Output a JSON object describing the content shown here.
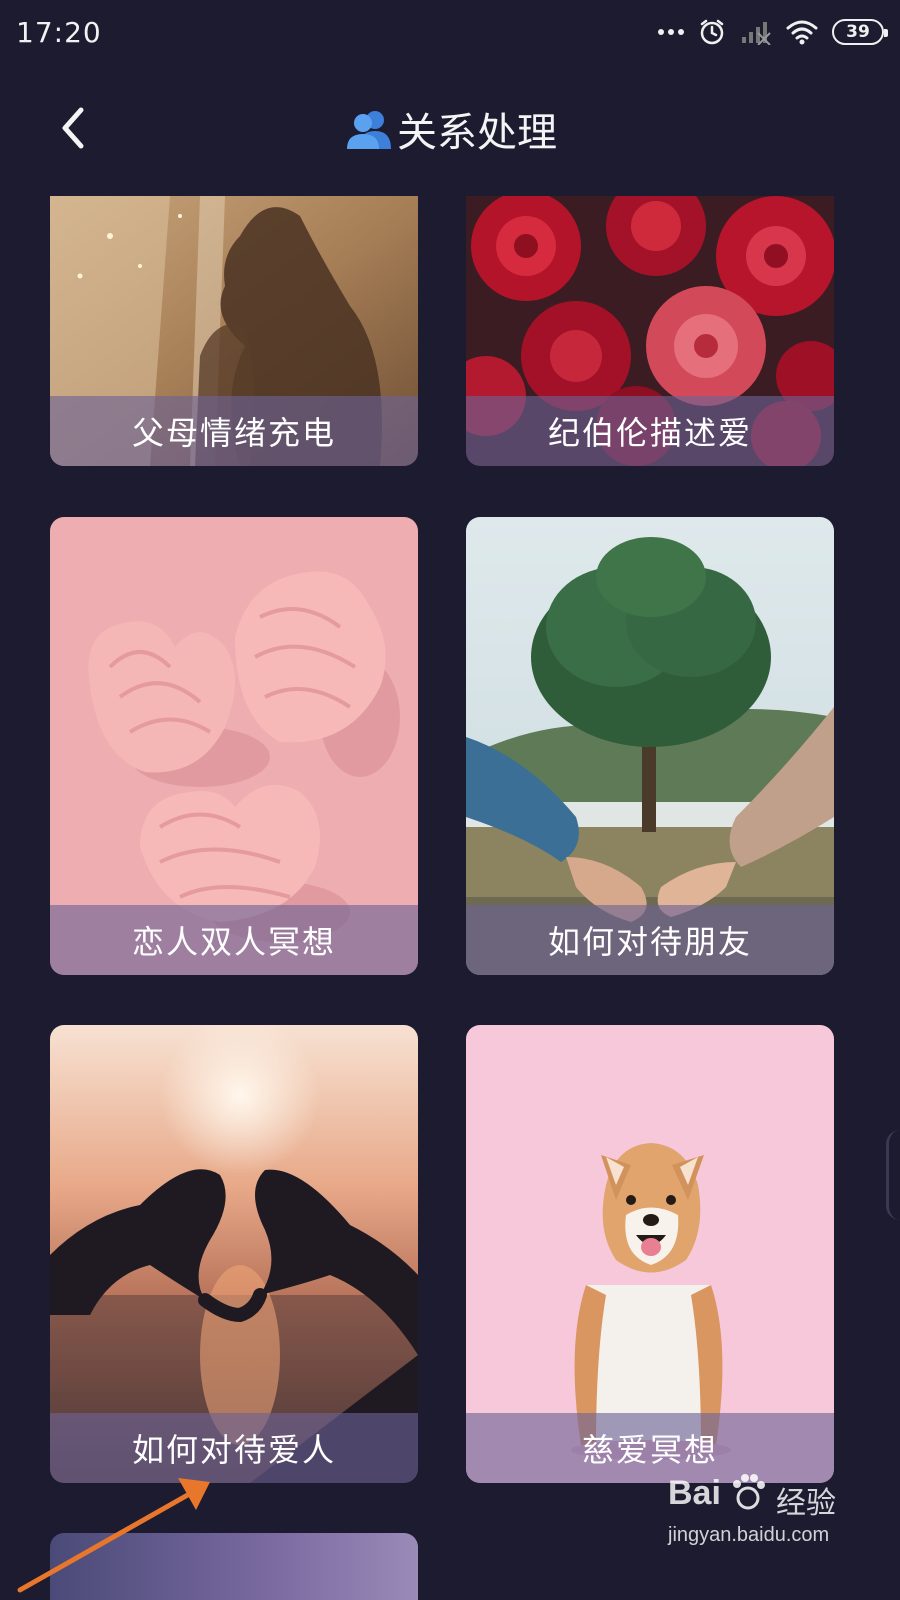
{
  "status_bar": {
    "time": "17:20",
    "icons": [
      "more-dots-icon",
      "alarm-icon",
      "cellular-signal-icon",
      "wifi-icon",
      "battery-icon"
    ],
    "battery_level": "39"
  },
  "header": {
    "back_icon": "chevron-left-icon",
    "title_icon": "two-people-icon",
    "title": "关系处理"
  },
  "cards": [
    {
      "label": "父母情绪充电",
      "image": "parent-child-silhouette-photo"
    },
    {
      "label": "纪伯伦描述爱",
      "image": "red-roses-photo"
    },
    {
      "label": "恋人双人冥想",
      "image": "pink-heart-meringues-photo"
    },
    {
      "label": "如何对待朋友",
      "image": "holding-hands-tree-photo"
    },
    {
      "label": "如何对待爱人",
      "image": "heart-hands-sunset-photo"
    },
    {
      "label": "慈爱冥想",
      "image": "shiba-dog-pink-photo"
    }
  ],
  "watermark": {
    "brand": "Bai",
    "brand_cn": "经验",
    "url": "jingyan.baidu.com"
  },
  "colors": {
    "background": "#1c1b30",
    "label_overlay": "#6c6296",
    "annotation_arrow": "#e8762b"
  }
}
